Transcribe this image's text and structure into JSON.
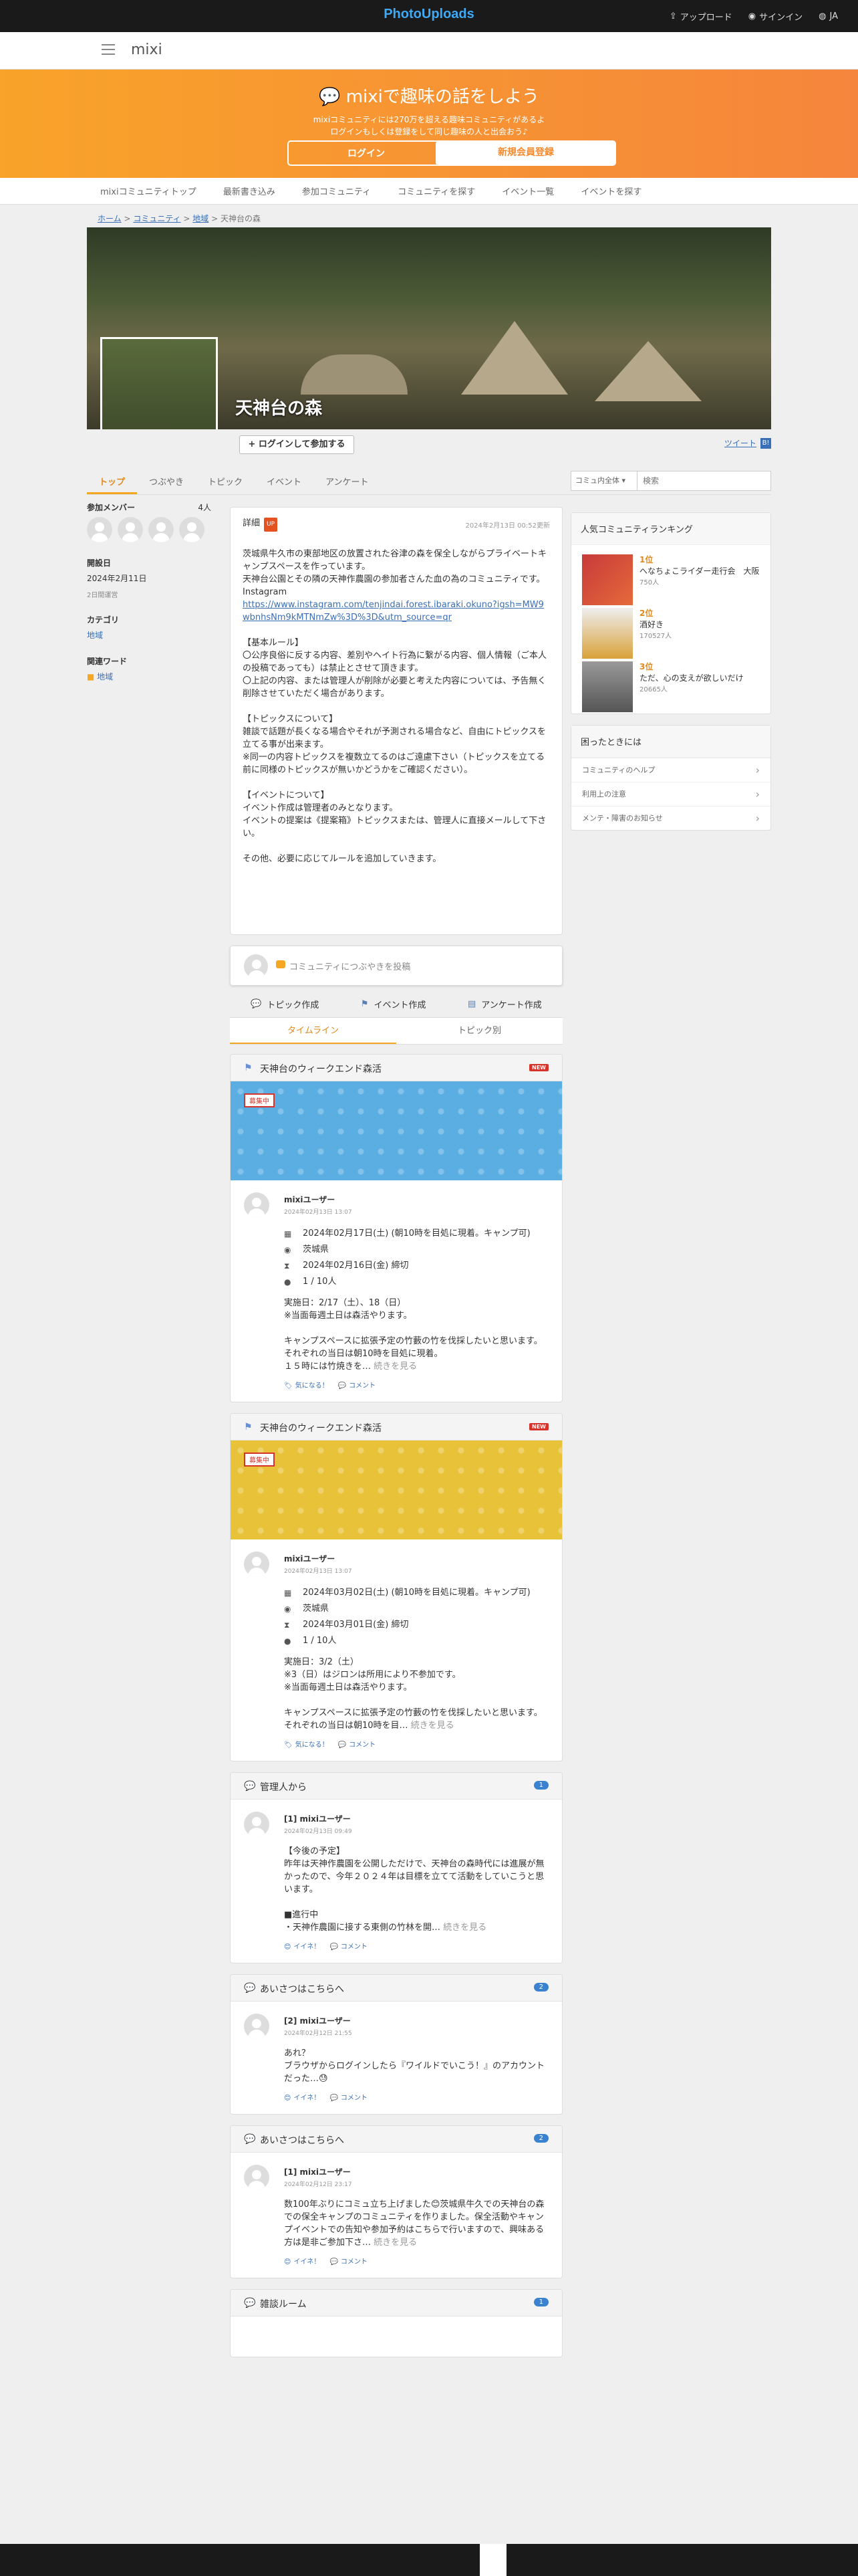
{
  "topbar": {
    "logo": "PhotoUploads",
    "upload": "アップロード",
    "signin": "サインイン",
    "lang": "JA"
  },
  "header": {
    "brand": "mixi"
  },
  "banner": {
    "title": "mixiで趣味の話をしよう",
    "sub1": "mixiコミュニティには270万を超える趣味コミュニティがあるよ",
    "sub2": "ログインもしくは登録をして同じ趣味の人と出会おう♪",
    "login": "ログイン",
    "register": "新規会員登録"
  },
  "subnav": [
    "mixiコミュニティトップ",
    "最新書き込み",
    "参加コミュニティ",
    "コミュニティを探す",
    "イベント一覧",
    "イベントを探す"
  ],
  "breadcrumb": {
    "home": "ホーム",
    "community": "コミュニティ",
    "area": "地域",
    "current": "天神台の森"
  },
  "hero": {
    "title": "天神台の森"
  },
  "join": {
    "label": "+ ログインして参加する",
    "tweet": "ツイート"
  },
  "tabs": [
    "トップ",
    "つぶやき",
    "トピック",
    "イベント",
    "アンケート"
  ],
  "search": {
    "scope": "コミュ内全体",
    "placeholder": "検索"
  },
  "left": {
    "members_label": "参加メンバー",
    "members_count": "4人",
    "opened_label": "開設日",
    "opened_date": "2024年2月11日",
    "opened_age": "2日間運営",
    "category_label": "カテゴリ",
    "category": "地域",
    "keyword_label": "関連ワード",
    "keyword": "地域"
  },
  "detail": {
    "label": "詳細",
    "badge": "UP",
    "date": "2024年2月13日 00:52更新",
    "p1": "茨城県牛久市の東部地区の放置された谷津の森を保全しながらプライベートキャンプスペースを作っています。\n天神台公園とその隣の天神作農園の参加者さんた血の為のコミュニティです。\nInstagram",
    "link": "https://www.instagram.com/tenjindai.forest.ibaraki.okuno?igsh=MW9wbnhsNm9kMTNmZw%3D%3D&utm_source=qr",
    "p2": "\n\n【基本ルール】\n〇公序良俗に反する内容、差別やヘイト行為に繋がる内容、個人情報（ご本人の投稿であっても）は禁止とさせて頂きます。\n〇上記の内容、または管理人が削除が必要と考えた内容については、予告無く削除させていただく場合があります。\n\n【トピックスについて】\n雑談で話題が長くなる場合やそれが予測される場合など、自由にトピックスを立てる事が出来ます。\n※同一の内容トピックスを複数立てるのはご遠慮下さい（トピックスを立てる前に同様のトピックスが無いかどうかをご確認ください）。\n\n【イベントについて】\nイベント作成は管理者のみとなります。\nイベントの提案は《提案箱》トピックスまたは、管理人に直接メールして下さい。\n\nその他、必要に応じてルールを追加していきます。"
  },
  "post": {
    "placeholder": "コミュニティにつぶやきを投稿"
  },
  "actions": {
    "topic": "トピック作成",
    "event": "イベント作成",
    "survey": "アンケート作成"
  },
  "subtabs": {
    "timeline": "タイムライン",
    "by_topic": "トピック別"
  },
  "events": [
    {
      "title": "天神台のウィークエンド森活",
      "new": "NEW",
      "tag": "募集中",
      "user": "mixiユーザー",
      "time": "2024年02月13日 13:07",
      "date": "2024年02月17日(土) (朝10時を目処に現着。キャンプ可)",
      "place": "茨城県",
      "deadline": "2024年02月16日(金) 締切",
      "people": "1 / 10人",
      "text": "実施日：2/17（土）、18（日）\n※当面毎週土日は森活やります。\n\nキャンプスペースに拡張予定の竹藪の竹を伐採したいと思います。\nそれぞれの当日は朝10時を目処に現着。\n１５時には竹焼きを…",
      "more": " 続きを見る",
      "like": "気になる！",
      "comment": "コメント",
      "color": "#5aaee2"
    },
    {
      "title": "天神台のウィークエンド森活",
      "new": "NEW",
      "tag": "募集中",
      "user": "mixiユーザー",
      "time": "2024年02月13日 13:07",
      "date": "2024年03月02日(土) (朝10時を目処に現着。キャンプ可)",
      "place": "茨城県",
      "deadline": "2024年03月01日(金) 締切",
      "people": "1 / 10人",
      "text": "実施日：3/2（土）\n※3（日）はジロンは所用により不参加です。\n※当面毎週土日は森活やります。\n\nキャンプスペースに拡張予定の竹藪の竹を伐採したいと思います。\nそれぞれの当日は朝10時を目…",
      "more": " 続きを見る",
      "like": "気になる！",
      "comment": "コメント",
      "color": "#e8c33a"
    }
  ],
  "topics": [
    {
      "title": "管理人から",
      "count": "1",
      "user": "[1] mixiユーザー",
      "time": "2024年02月13日 09:49",
      "text": "【今後の予定】\n昨年は天神作農園を公開しただけで、天神台の森時代には進展が無かったので、今年２０２４年は目標を立てて活動をしていこうと思います。\n\n■進行中\n・天神作農園に接する東側の竹林を開…",
      "more": " 続きを見る",
      "like": "イイネ！",
      "comment": "コメント"
    },
    {
      "title": "あいさつはこちらへ",
      "count": "2",
      "user": "[2] mixiユーザー",
      "time": "2024年02月12日 21:55",
      "text": "あれ？\nブラウザからログインしたら『ワイルドでいこう！』のアカウントだった…😓",
      "more": "",
      "like": "イイネ！",
      "comment": "コメント"
    },
    {
      "title": "あいさつはこちらへ",
      "count": "2",
      "user": "[1] mixiユーザー",
      "time": "2024年02月12日 23:17",
      "text": "数100年ぶりにコミュ立ち上げました😊茨城県牛久での天神台の森での保全キャンプのコミュニティを作りました。保全活動やキャンプイベントでの告知や参加予約はこちらで行いますので、興味ある方は是非ご参加下さ…",
      "more": " 続きを見る",
      "like": "イイネ！",
      "comment": "コメント"
    },
    {
      "title": "雑談ルーム",
      "count": "1"
    }
  ],
  "ranking": {
    "title": "人気コミュニティランキング",
    "items": [
      {
        "rank": "1位",
        "name": "へなちょこライダー走行会　大阪",
        "count": "750人"
      },
      {
        "rank": "2位",
        "name": "酒好き",
        "count": "170527人"
      },
      {
        "rank": "3位",
        "name": "ただ、心の支えが欲しいだけ",
        "count": "20665人"
      }
    ]
  },
  "help": {
    "title": "困ったときには",
    "items": [
      "コミュニティのヘルプ",
      "利用上の注意",
      "メンテ・障害のお知らせ"
    ]
  },
  "colors": {
    "accent": "#f5a623",
    "link": "#3a6fb7",
    "new": "#d6342a"
  }
}
